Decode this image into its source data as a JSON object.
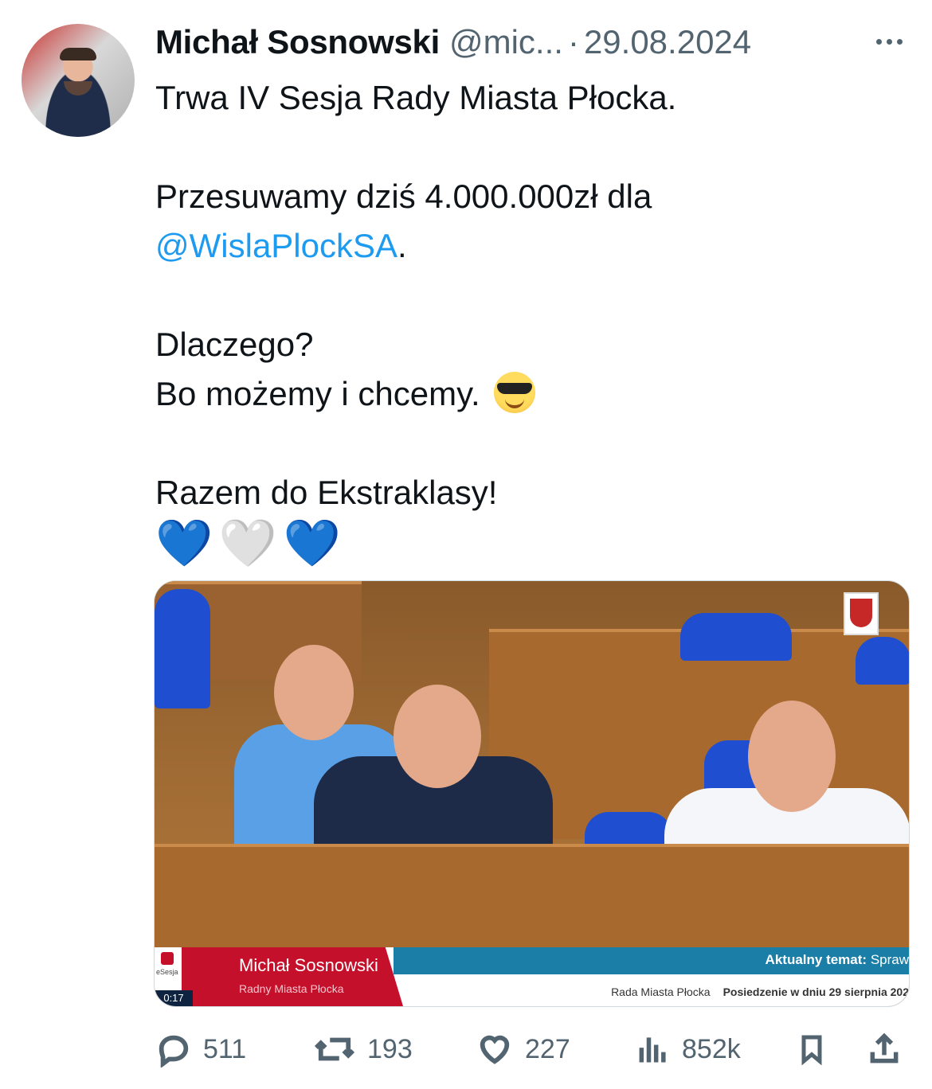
{
  "author": {
    "name": "Michał Sosnowski",
    "handle": "@mic...",
    "separator": "·",
    "date": "29.08.2024"
  },
  "tweet": {
    "line1": "Trwa IV Sesja Rady Miasta Płocka.",
    "line2": "Przesuwamy dziś 4.000.000zł dla",
    "mention": "@WislaPlockSA",
    "mention_suffix": ".",
    "line3": "Dlaczego?",
    "line4": "Bo możemy i chcemy.",
    "line5": "Razem do Ekstraklasy!",
    "hearts": [
      "💙",
      "🤍",
      "💙"
    ]
  },
  "media": {
    "lower_third": {
      "logo_text": "eSesja",
      "time": "0:17",
      "name": "Michał Sosnowski",
      "role": "Radny Miasta Płocka",
      "topic_label": "Aktualny temat:",
      "topic_value": "Spraw",
      "org": "Rada Miasta Płocka",
      "session": "Posiedzenie w dniu 29 sierpnia 202"
    }
  },
  "actions": {
    "replies": "511",
    "reposts": "193",
    "likes": "227",
    "views": "852k"
  },
  "colors": {
    "link": "#1d9bf0",
    "muted": "#536471"
  }
}
